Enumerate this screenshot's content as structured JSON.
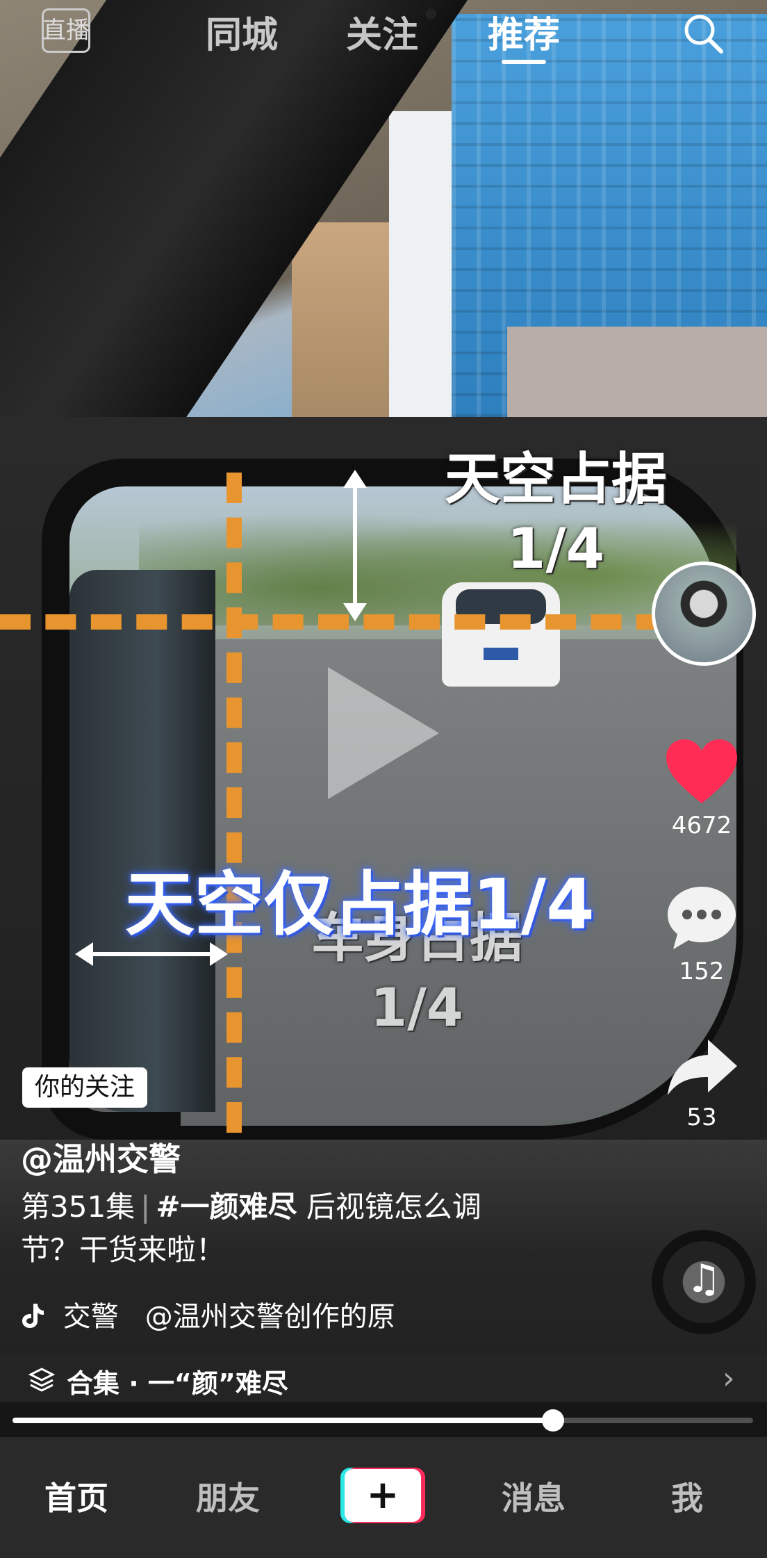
{
  "top_nav": {
    "live_label": "直播",
    "tabs": [
      {
        "label": "同城"
      },
      {
        "label": "关注"
      },
      {
        "label": "推荐"
      }
    ],
    "active_tab": "推荐"
  },
  "video": {
    "overlay_top_line1": "天空占据",
    "overlay_top_line2": "1/4",
    "overlay_car_line1": "车身占据",
    "overlay_car_line2": "1/4",
    "caption": "天空仅占据1/4"
  },
  "right_rail": {
    "likes": "4672",
    "comments": "152",
    "shares": "53",
    "like_color": "#ff2d55"
  },
  "info": {
    "follow_badge": "你的关注",
    "author": "@温州交警",
    "desc_episode": "第351集",
    "desc_separator": "|",
    "desc_tag": "#一颜难尽",
    "desc_text": "后视镜怎么调节？干货来啦！",
    "music_artist": "交警",
    "music_title": "@温州交警创作的原"
  },
  "collection": {
    "label": "合集 · 一“颜”难尽"
  },
  "progress": {
    "fraction": 0.73
  },
  "tabbar": {
    "items": [
      {
        "label": "首页"
      },
      {
        "label": "朋友"
      },
      {
        "label": "消息"
      },
      {
        "label": "我"
      }
    ],
    "create_icon": "+"
  }
}
